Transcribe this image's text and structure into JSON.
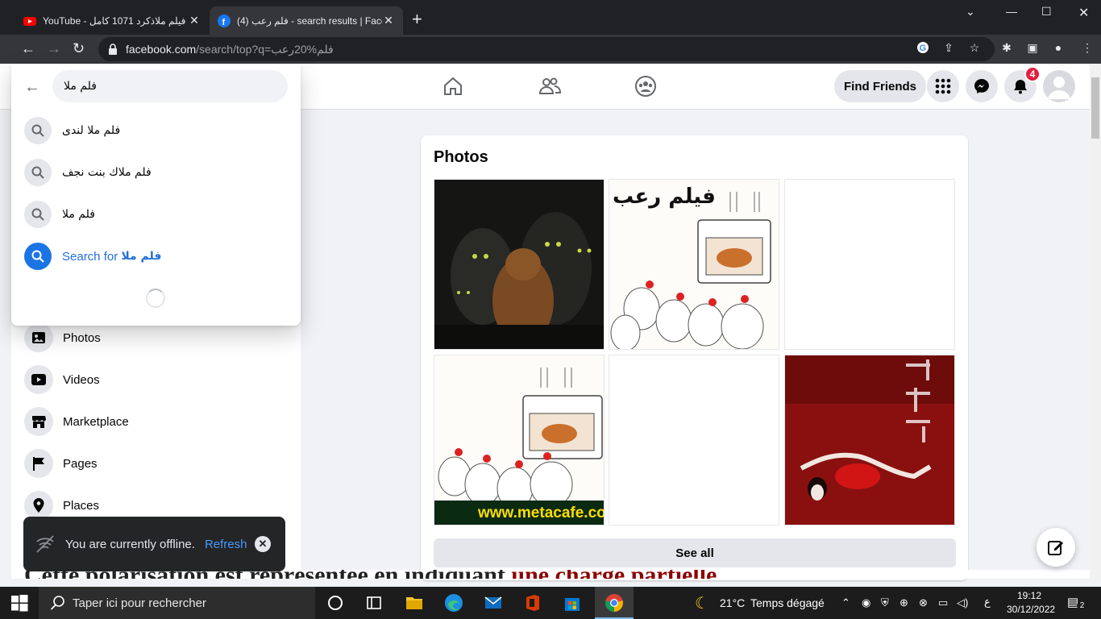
{
  "browser": {
    "tabs": [
      {
        "title": "YouTube - فيلم ملاذكرد 1071 كامل",
        "active": false
      },
      {
        "title": "(4) فلم رعب - search results | Face",
        "active": true
      }
    ],
    "url_host": "facebook.com",
    "url_path": "/search/top?q=فلم%20رعب"
  },
  "fb_header": {
    "find_friends": "Find Friends",
    "notification_count": "4"
  },
  "search": {
    "query": "فلم ملا",
    "suggestions": [
      "فلم ملا لندى",
      "فلم ملاك بنت نجف",
      "فلم ملا"
    ],
    "search_for_prefix": "Search for ",
    "search_for_query": "فلم ملا"
  },
  "sidebar": {
    "items": [
      "Photos",
      "Videos",
      "Marketplace",
      "Pages",
      "Places"
    ]
  },
  "photos": {
    "title": "Photos",
    "see_all": "See all",
    "caption_arabic": "فيلم رعب",
    "watermark": "www.metacafe.com"
  },
  "toast": {
    "message": "You are currently offline.",
    "refresh": "Refresh"
  },
  "background_doc": {
    "text_black": "Cette polarisation est représentée en indiquant ",
    "text_red": "une charge partielle"
  },
  "taskbar": {
    "search_placeholder": "Taper ici pour rechercher",
    "weather_temp": "21°C",
    "weather_desc": "Temps dégagé",
    "lang": "ع",
    "time": "19:12",
    "date": "30/12/2022",
    "notif_count": "2"
  },
  "colors": {
    "fb_blue": "#1b74e4",
    "link_blue": "#216fdb",
    "badge_red": "#e41e3f",
    "chrome_dark": "#202124"
  }
}
